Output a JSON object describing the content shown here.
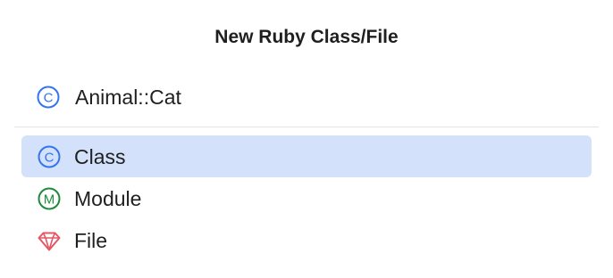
{
  "dialog": {
    "title": "New Ruby Class/File",
    "name_field": {
      "value": "Animal::Cat",
      "placeholder": "",
      "icon": "class-c-icon"
    },
    "kinds": [
      {
        "label": "Class",
        "icon": "class-c-icon",
        "selected": true
      },
      {
        "label": "Module",
        "icon": "module-m-icon",
        "selected": false
      },
      {
        "label": "File",
        "icon": "ruby-gem-icon",
        "selected": false
      }
    ]
  },
  "colors": {
    "class_icon": "#3574f0",
    "module_icon": "#208a3c",
    "ruby_icon": "#e55765",
    "selection": "#d4e1fb"
  }
}
